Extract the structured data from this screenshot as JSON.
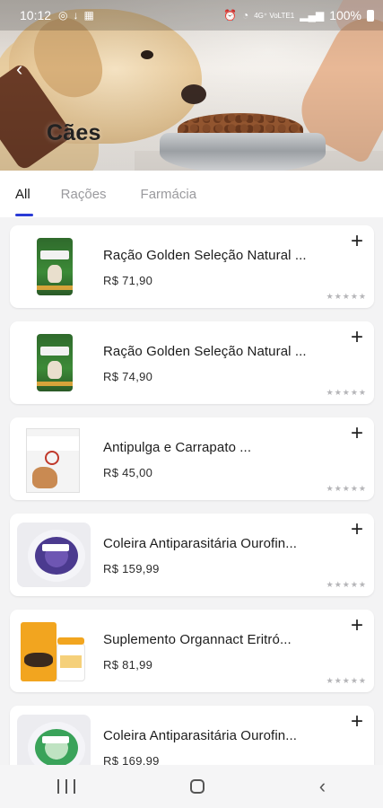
{
  "status_bar": {
    "time": "10:12",
    "battery": "100%",
    "network_labels": "4G⁺ VoLTE1"
  },
  "header": {
    "title": "Cães"
  },
  "tabs": [
    {
      "label": "All",
      "active": true
    },
    {
      "label": "Rações",
      "active": false
    },
    {
      "label": "Farmácia",
      "active": false
    }
  ],
  "products": [
    {
      "name": "Ração Golden Seleção Natural ...",
      "price": "R$ 71,90",
      "rating": "★★★★★",
      "image": "golden-dog-food-bag"
    },
    {
      "name": "Ração Golden Seleção Natural ...",
      "price": "R$ 74,90",
      "rating": "★★★★★",
      "image": "golden-dog-food-bag"
    },
    {
      "name": "Antipulga e Carrapato ...",
      "price": "R$ 45,00",
      "rating": "★★★★★",
      "image": "flea-tick-box"
    },
    {
      "name": "Coleira Antiparasitária Ourofin...",
      "price": "R$ 159,99",
      "rating": "★★★★★",
      "image": "leevre-collar-purple"
    },
    {
      "name": "Suplemento Organnact Eritró...",
      "price": "R$ 81,99",
      "rating": "★★★★★",
      "image": "organnact-supplement"
    },
    {
      "name": "Coleira Antiparasitária Ourofin...",
      "price": "R$ 169,99",
      "rating": "★★★★★",
      "image": "leevre-collar-green"
    }
  ],
  "add_icon": "+",
  "colors": {
    "accent": "#2a3bd6",
    "background": "#f3f3f4",
    "card": "#ffffff",
    "muted_tab": "#9a9a9e",
    "stars": "#b5b5b8"
  },
  "icons": {
    "back": "chevron-left-icon",
    "add": "plus-icon",
    "nav_recents": "recents-icon",
    "nav_home": "home-icon",
    "nav_back": "back-icon"
  }
}
